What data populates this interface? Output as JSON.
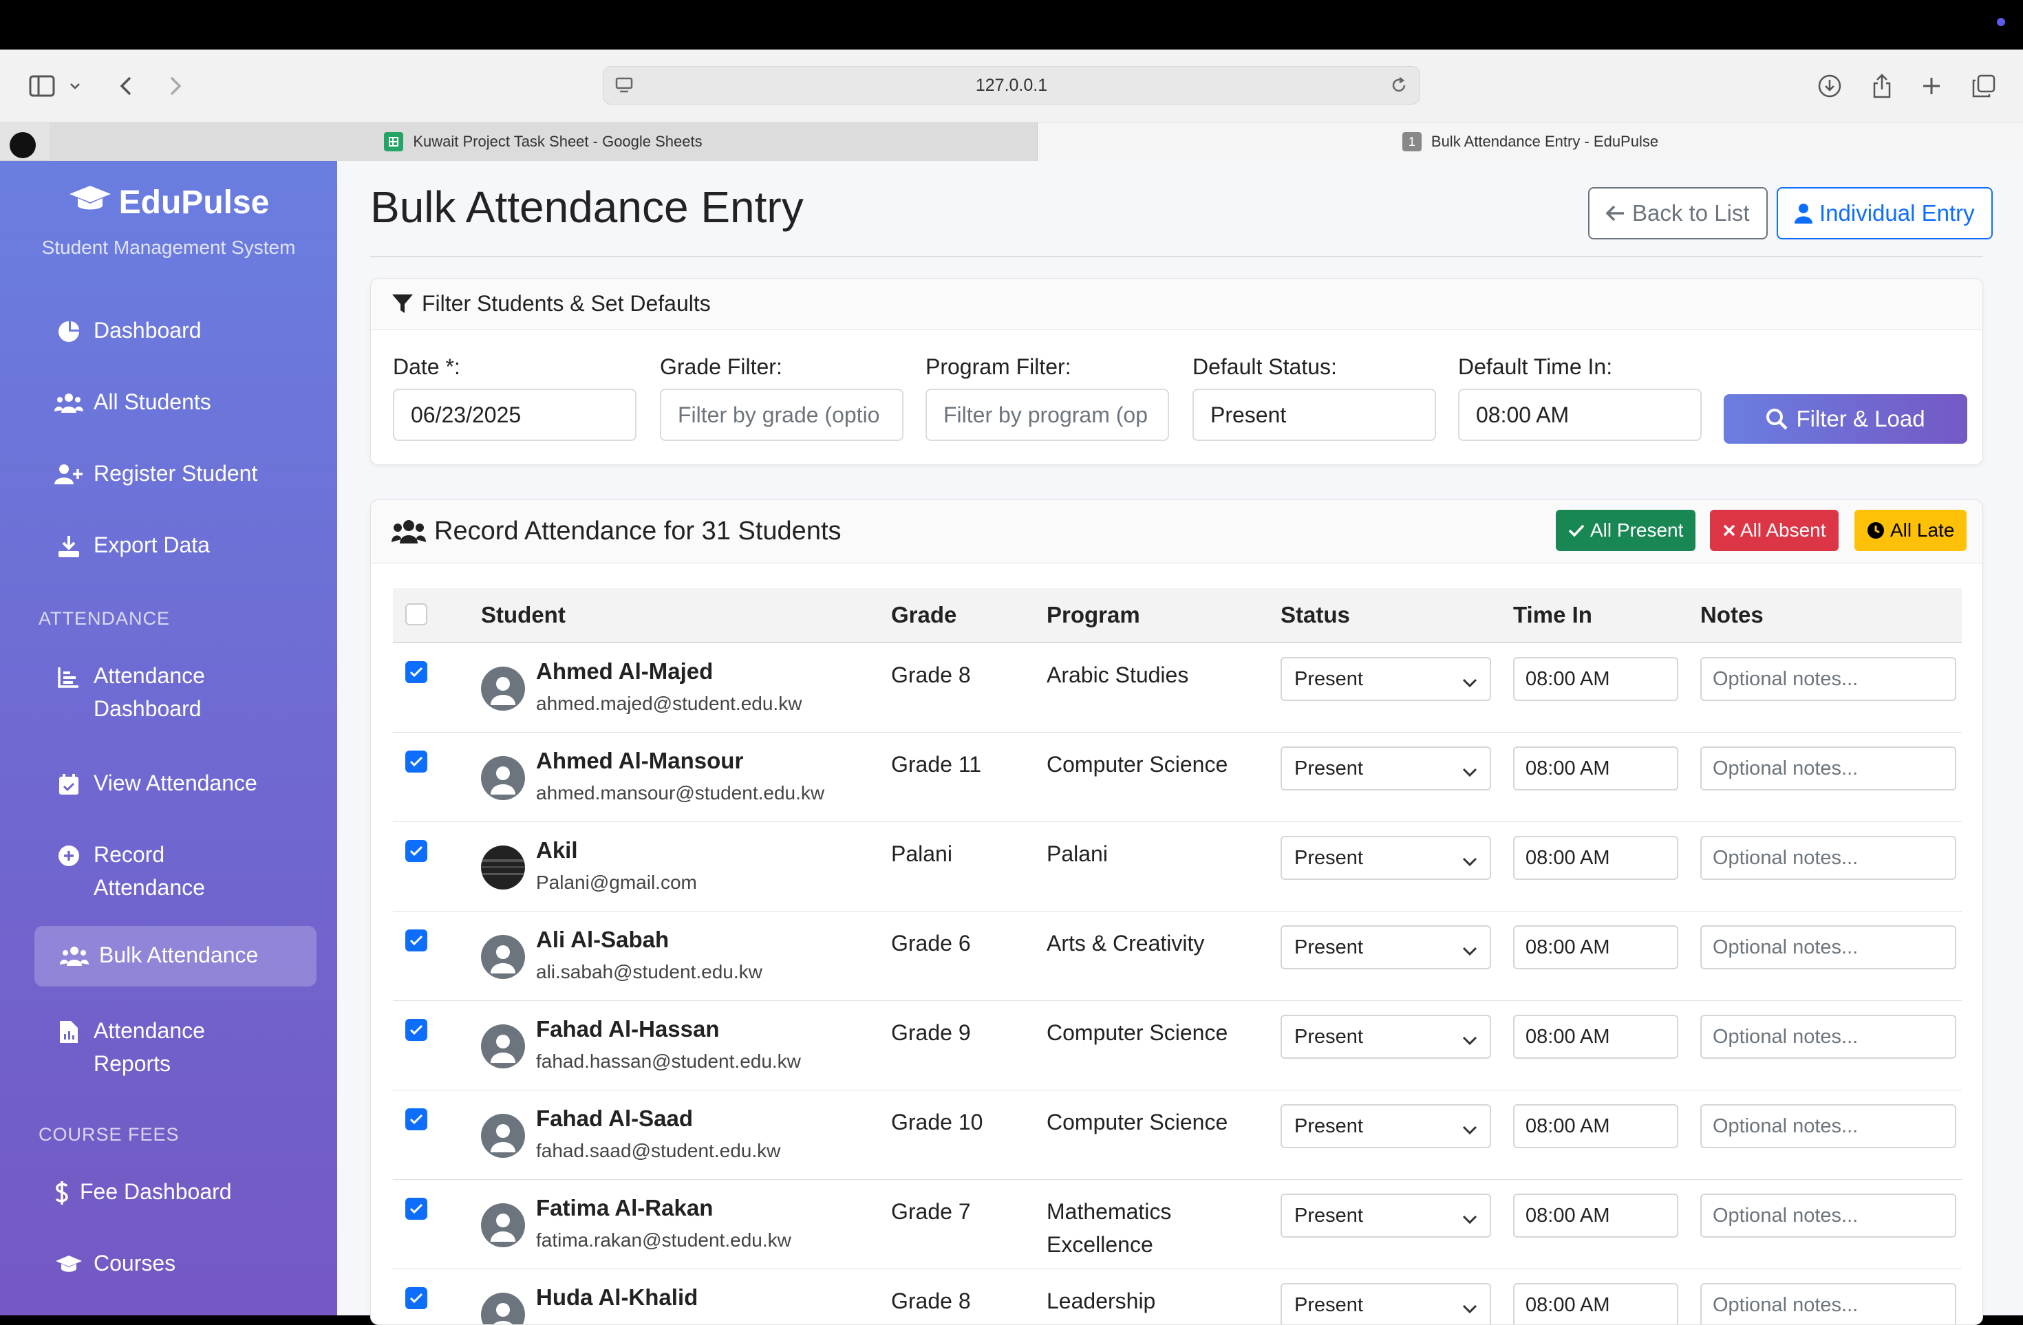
{
  "browser": {
    "url": "127.0.0.1",
    "tabs": [
      {
        "label": "Kuwait Project Task Sheet - Google Sheets"
      },
      {
        "label": "Bulk Attendance Entry - EduPulse",
        "badge": "1"
      }
    ]
  },
  "sidebar": {
    "brand": "EduPulse",
    "subtitle": "Student Management System",
    "items": [
      {
        "label": "Dashboard",
        "icon": "chart-pie-icon"
      },
      {
        "label": "All Students",
        "icon": "users-icon"
      },
      {
        "label": "Register Student",
        "icon": "user-plus-icon"
      },
      {
        "label": "Export Data",
        "icon": "download-icon"
      }
    ],
    "attendance_heading": "ATTENDANCE",
    "attendance_items": [
      {
        "label": "Attendance Dashboard",
        "icon": "chart-line-icon"
      },
      {
        "label": "View Attendance",
        "icon": "calendar-check-icon"
      },
      {
        "label": "Record Attendance",
        "icon": "plus-circle-icon"
      },
      {
        "label": "Bulk Attendance",
        "icon": "users-icon",
        "active": true
      },
      {
        "label": "Attendance Reports",
        "icon": "file-chart-icon"
      }
    ],
    "fees_heading": "COURSE FEES",
    "fees_items": [
      {
        "label": "Fee Dashboard",
        "icon": "dollar-icon"
      },
      {
        "label": "Courses",
        "icon": "graduation-cap-icon"
      }
    ]
  },
  "page": {
    "title": "Bulk Attendance Entry",
    "back_label": "Back to List",
    "individual_label": "Individual Entry"
  },
  "filter": {
    "heading": "Filter Students & Set Defaults",
    "date_label": "Date *:",
    "date_value": "06/23/2025",
    "grade_label": "Grade Filter:",
    "grade_placeholder": "Filter by grade (optio",
    "program_label": "Program Filter:",
    "program_placeholder": "Filter by program (op",
    "status_label": "Default Status:",
    "status_value": "Present",
    "time_label": "Default Time In:",
    "time_value": "08:00 AM",
    "button_label": "Filter & Load"
  },
  "record": {
    "heading": "Record Attendance for 31 Students",
    "all_present": "All Present",
    "all_absent": "All Absent",
    "all_late": "All Late",
    "columns": {
      "student": "Student",
      "grade": "Grade",
      "program": "Program",
      "status": "Status",
      "time": "Time In",
      "notes": "Notes"
    },
    "notes_placeholder": "Optional notes...",
    "rows": [
      {
        "name": "Ahmed Al-Majed",
        "email": "ahmed.majed@student.edu.kw",
        "grade": "Grade 8",
        "program": "Arabic Studies",
        "status": "Present",
        "time": "08:00 AM"
      },
      {
        "name": "Ahmed Al-Mansour",
        "email": "ahmed.mansour@student.edu.kw",
        "grade": "Grade 11",
        "program": "Computer Science",
        "status": "Present",
        "time": "08:00 AM"
      },
      {
        "name": "Akil",
        "email": "Palani@gmail.com",
        "grade": "Palani",
        "program": "Palani",
        "status": "Present",
        "time": "08:00 AM"
      },
      {
        "name": "Ali Al-Sabah",
        "email": "ali.sabah@student.edu.kw",
        "grade": "Grade 6",
        "program": "Arts & Creativity",
        "status": "Present",
        "time": "08:00 AM"
      },
      {
        "name": "Fahad Al-Hassan",
        "email": "fahad.hassan@student.edu.kw",
        "grade": "Grade 9",
        "program": "Computer Science",
        "status": "Present",
        "time": "08:00 AM"
      },
      {
        "name": "Fahad Al-Saad",
        "email": "fahad.saad@student.edu.kw",
        "grade": "Grade 10",
        "program": "Computer Science",
        "status": "Present",
        "time": "08:00 AM"
      },
      {
        "name": "Fatima Al-Rakan",
        "email": "fatima.rakan@student.edu.kw",
        "grade": "Grade 7",
        "program": "Mathematics Excellence",
        "status": "Present",
        "time": "08:00 AM"
      },
      {
        "name": "Huda Al-Khalid",
        "email": "",
        "grade": "Grade 8",
        "program": "Leadership",
        "status": "Present",
        "time": "08:00 AM"
      }
    ]
  }
}
